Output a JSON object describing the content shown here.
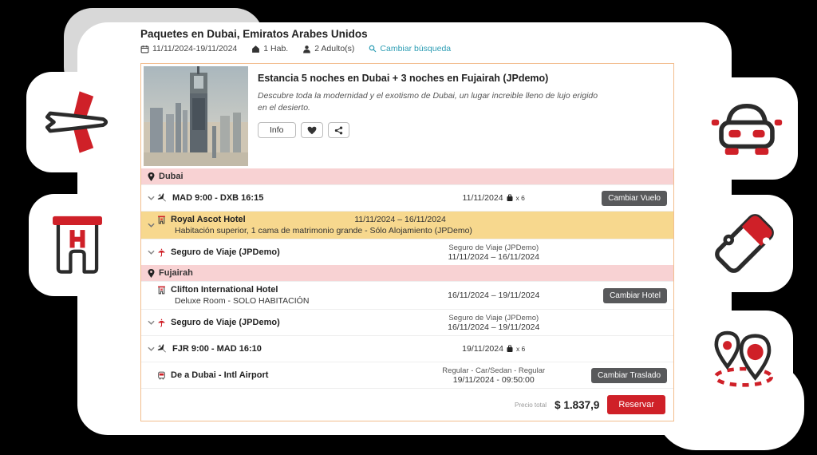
{
  "header": {
    "title": "Paquetes en Dubai, Emiratos Arabes Unidos",
    "date_range": "11/11/2024-19/11/2024",
    "rooms": "1 Hab.",
    "adults": "2 Adulto(s)",
    "change_search": "Cambiar búsqueda"
  },
  "package": {
    "title": "Estancia 5 noches en Dubai + 3 noches en Fujairah (JPdemo)",
    "description": "Descubre toda la modernidad y el exotismo de Dubai, un lugar increible lleno de lujo erigido en el desierto.",
    "info_label": "Info"
  },
  "itinerary": {
    "sections": [
      {
        "name": "Dubai"
      },
      {
        "name": "Fujairah"
      }
    ],
    "rows": [
      {
        "type": "flight",
        "title": "MAD 9:00 - DXB 16:15",
        "date": "11/11/2024",
        "bags": "x 6",
        "button": "Cambiar Vuelo"
      },
      {
        "type": "hotel",
        "title": "Royal Ascot Hotel",
        "subtitle": "Habitación superior, 1 cama de matrimonio grande - Sólo Alojamiento (JPDemo)",
        "dates": "11/11/2024 – 16/11/2024"
      },
      {
        "type": "insurance",
        "title": "Seguro de Viaje (JPDemo)",
        "center1": "Seguro de Viaje (JPDemo)",
        "center2": "11/11/2024 – 16/11/2024"
      },
      {
        "type": "hotel",
        "title": "Clifton International Hotel",
        "subtitle": "Deluxe Room - SOLO HABITACIÓN",
        "dates": "16/11/2024 – 19/11/2024",
        "button": "Cambiar Hotel"
      },
      {
        "type": "insurance",
        "title": "Seguro de Viaje (JPDemo)",
        "center1": "Seguro de Viaje (JPDemo)",
        "center2": "16/11/2024 – 19/11/2024"
      },
      {
        "type": "flight",
        "title": "FJR 9:00 - MAD 16:10",
        "date": "19/11/2024",
        "bags": "x 6"
      },
      {
        "type": "transfer",
        "title": "De a Dubai - Intl Airport",
        "center1": "Regular - Car/Sedan - Regular",
        "center2": "19/11/2024 - 09:50:00",
        "button": "Cambiar Traslado"
      }
    ]
  },
  "footer": {
    "price_label": "Precio total",
    "price": "$ 1.837,9",
    "reserve_label": "Reservar"
  },
  "colors": {
    "accent_red": "#cf2028",
    "section_pink": "#f8d2d3",
    "hotel_row_yellow": "#f7d88e",
    "link_teal": "#2d9db4",
    "button_dark": "#58595b",
    "card_border": "#f2bd8e"
  }
}
